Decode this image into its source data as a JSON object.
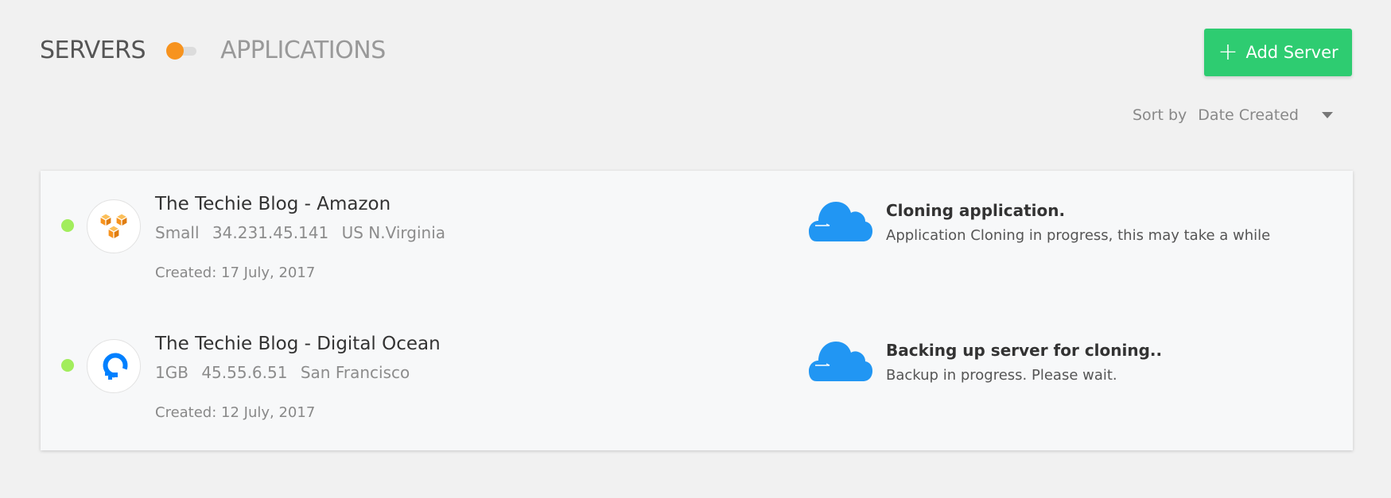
{
  "header": {
    "servers_tab": "SERVERS",
    "applications_tab": "APPLICATIONS",
    "toggle_on": true
  },
  "actions": {
    "add_server_label": "Add Server"
  },
  "sort": {
    "label": "Sort by",
    "selected": "Date Created"
  },
  "colors": {
    "accent_green": "#2ecc71",
    "toggle_orange": "#f7931e",
    "status_online": "#a2ed5c",
    "cloud_blue": "#2196f3"
  },
  "servers": [
    {
      "name": "The Techie Blog - Amazon",
      "size": "Small",
      "ip": "34.231.45.141",
      "location": "US N.Virginia",
      "created": "Created: 17 July, 2017",
      "provider_icon": "aws-icon",
      "task_title": "Cloning application.",
      "task_desc": "Application Cloning in progress, this may take a while"
    },
    {
      "name": "The Techie Blog - Digital Ocean",
      "size": "1GB",
      "ip": "45.55.6.51",
      "location": "San Francisco",
      "created": "Created: 12 July, 2017",
      "provider_icon": "digitalocean-icon",
      "task_title": "Backing up server for cloning..",
      "task_desc": "Backup in progress. Please wait."
    }
  ]
}
